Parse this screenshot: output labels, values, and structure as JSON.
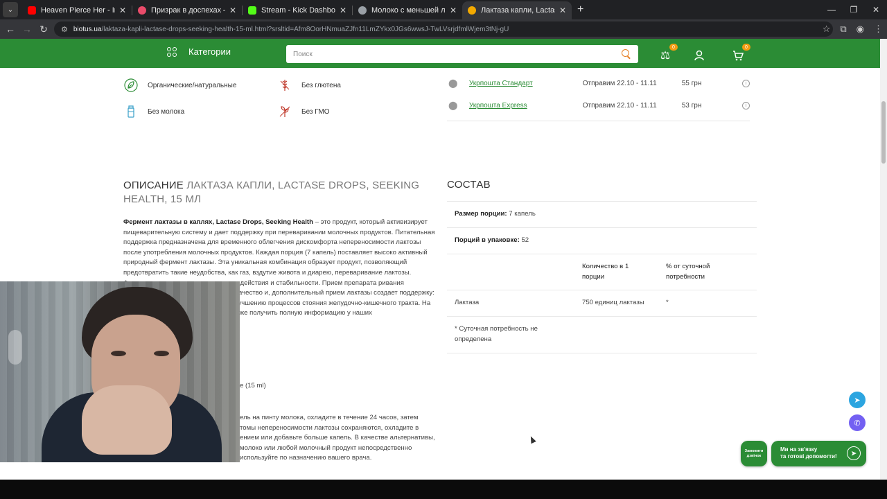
{
  "browser": {
    "tabs": [
      {
        "title": "Heaven Pierce Her - In Absentia",
        "favicon_color": "#ff0000"
      },
      {
        "title": "Призрак в доспехах — смотреть",
        "favicon_color": "#e94b6a"
      },
      {
        "title": "Stream - Kick Dashboard",
        "favicon_color": "#53fc18"
      },
      {
        "title": "Молоко с меньшей лактозой",
        "favicon_color": "#9aa0a6"
      },
      {
        "title": "Лактаза капли, Lactase Drops, S",
        "favicon_color": "#f2a900"
      }
    ],
    "url_host": "biotus.ua",
    "url_path": "/laktaza-kapli-lactase-drops-seeking-health-15-ml.html?srsltid=Afm8OorHNmuaZJfn11LmZYkx0JGs6wwsJ-TwLVsrjdfmlWjem3tNj-gU"
  },
  "header": {
    "categories_label": "Категории",
    "search_placeholder": "Поиск",
    "compare_count": "0",
    "cart_count": "0"
  },
  "features": [
    {
      "label": "Органические/натуральные",
      "icon": "leaf-icon"
    },
    {
      "label": "Без глютена",
      "icon": "wheat-icon"
    },
    {
      "label": "Без молока",
      "icon": "milk-icon"
    },
    {
      "label": "Без ГМО",
      "icon": "gmo-icon"
    }
  ],
  "shipping": [
    {
      "name": "Укрпошта Стандарт",
      "date": "Отправим 22.10 - 11.11",
      "price": "55 грн"
    },
    {
      "name": "Укрпошта Express",
      "date": "Отправим 22.10 - 11.11",
      "price": "53 грн"
    }
  ],
  "description": {
    "title_main": "ОПИСАНИЕ",
    "title_sub": "ЛАКТАЗА КАПЛИ, LACTASE DROPS, SEEKING HEALTH, 15 МЛ",
    "lead_bold": "Фермент лактазы в каплях, Lactase Drops, Seeking Health",
    "lead_rest": " – это продукт, который активизирует пищеварительную систему и дает поддержку при переваривании молочных продуктов. Питательная поддержка предназначена для временного облегчения дискомфорта непереносимости лактозы после употребления молочных продуктов. Каждая порция (7 капель) поставляет высоко активный природный фермент лактазы. Эта уникальная комбинация образует продукт, позволяющий предотвратить такие неудобства, как газ, вздутие живота и диарею, переваривание лактозы. Фермент специально максимального действия и стабильности. Прием препарата ривания молочных продуктов, оптимизирует качество и, дополнительный прием лактазы создает поддержку: ивизацию кишечной микрофлоры; улучшению процессов стояния желудочно-кишечного тракта. На сайте Biotus можно родукцией, но также получить полную информацию у наших",
    "volume_line": "e (15 ml)",
    "usage": "ель на пинту молока, охладите в течение 24 часов, затем томы непереносимости лактозы сохраняются, охладите в ением или добавьте больше капель. В качестве альтернативы, молоко или любой молочный продукт непосредственно используйте по назначению вашего врача."
  },
  "composition": {
    "title": "СОСТАВ",
    "serving_label": "Размер порции:",
    "serving_value": " 7 капель",
    "servings_label": "Порций в упаковке:",
    "servings_value": " 52",
    "col_qty": "Количество в 1 порции",
    "col_dv": "% от суточной потребности",
    "ingredient": "Лактаза",
    "ingredient_qty": "750 единиц лактазы",
    "ingredient_dv": "*",
    "footnote": "* Суточная потребность не определена"
  },
  "widgets": {
    "callback_label": "Замовити дзвінок",
    "chat_line1": "Ми на зв'язку",
    "chat_line2": "та готові допомогти!"
  },
  "colors": {
    "brand_green": "#2b8c35",
    "badge_orange": "#f39c12"
  }
}
